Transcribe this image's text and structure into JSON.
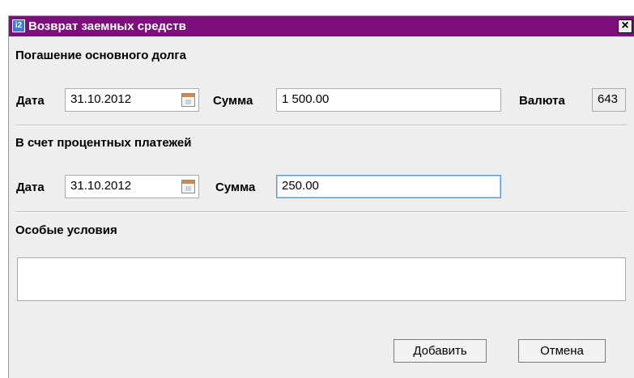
{
  "window": {
    "title": "Возврат заемных средств"
  },
  "principal": {
    "section_title": "Погашение основного долга",
    "date_label": "Дата",
    "date_value": "31.10.2012",
    "amount_label": "Сумма",
    "amount_value": "1 500.00",
    "currency_label": "Валюта",
    "currency_value": "643"
  },
  "interest": {
    "section_title": "В счет процентных платежей",
    "date_label": "Дата",
    "date_value": "31.10.2012",
    "amount_label": "Сумма",
    "amount_value": "250.00"
  },
  "special_conditions": {
    "section_title": "Особые условия",
    "value": ""
  },
  "buttons": {
    "add_label": "Добавить",
    "cancel_label": "Отмена"
  },
  "colors": {
    "titlebar": "#7d0f7d",
    "focus_border": "#5a9ad8"
  }
}
